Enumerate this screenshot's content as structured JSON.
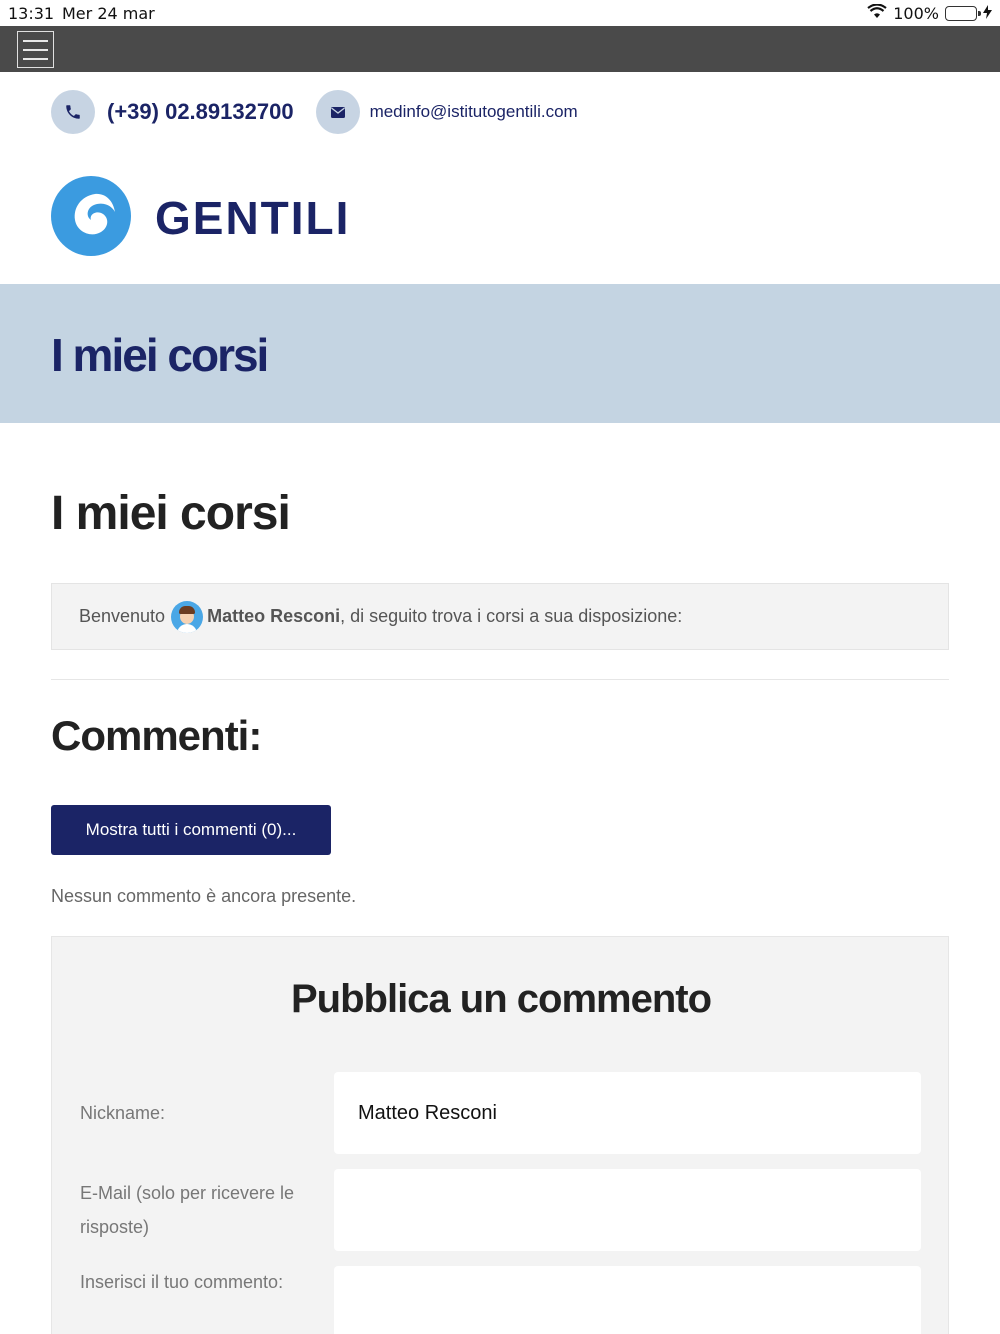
{
  "status_bar": {
    "time": "13:31",
    "date": "Mer 24 mar",
    "battery": "100%"
  },
  "contact": {
    "phone": "(+39) 02.89132700",
    "email": "medinfo@istitutogentili.com"
  },
  "logo": {
    "text": "GENTILI"
  },
  "banner": {
    "title": "I miei corsi"
  },
  "page": {
    "heading": "I miei corsi"
  },
  "welcome": {
    "prefix": "Benvenuto",
    "name": "Matteo Resconi",
    "suffix": ", di seguito trova i corsi a sua disposizione:"
  },
  "comments": {
    "title": "Commenti:",
    "show_all_label": "Mostra tutti i commenti (0)...",
    "empty_text": "Nessun commento è ancora presente."
  },
  "form": {
    "title": "Pubblica un commento",
    "nickname_label": "Nickname:",
    "nickname_value": "Matteo Resconi",
    "email_label": "E-Mail (solo per ricevere le risposte)",
    "email_value": "",
    "comment_label": "Inserisci il tuo commento:",
    "comment_value": ""
  },
  "colors": {
    "brand": "#1b2466",
    "banner_bg": "#c4d4e2",
    "logo_blue": "#3b9be0",
    "topbar": "#4a4a4a"
  },
  "icons": [
    "menu-icon",
    "wifi-icon",
    "battery-icon",
    "charging-icon",
    "phone-icon",
    "mail-icon",
    "logo-mark-icon",
    "user-avatar-icon"
  ]
}
